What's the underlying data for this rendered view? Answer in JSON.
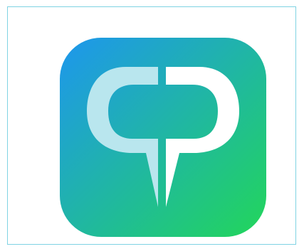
{
  "app_icon": {
    "icon": "speech-bubble-logo-icon",
    "colors": {
      "gradient_start": "#1e96ee",
      "gradient_end": "#22d65a",
      "left_shape": "#b9e6ee",
      "right_shape": "#ffffff",
      "frame_border": "#7fd3e3"
    }
  }
}
